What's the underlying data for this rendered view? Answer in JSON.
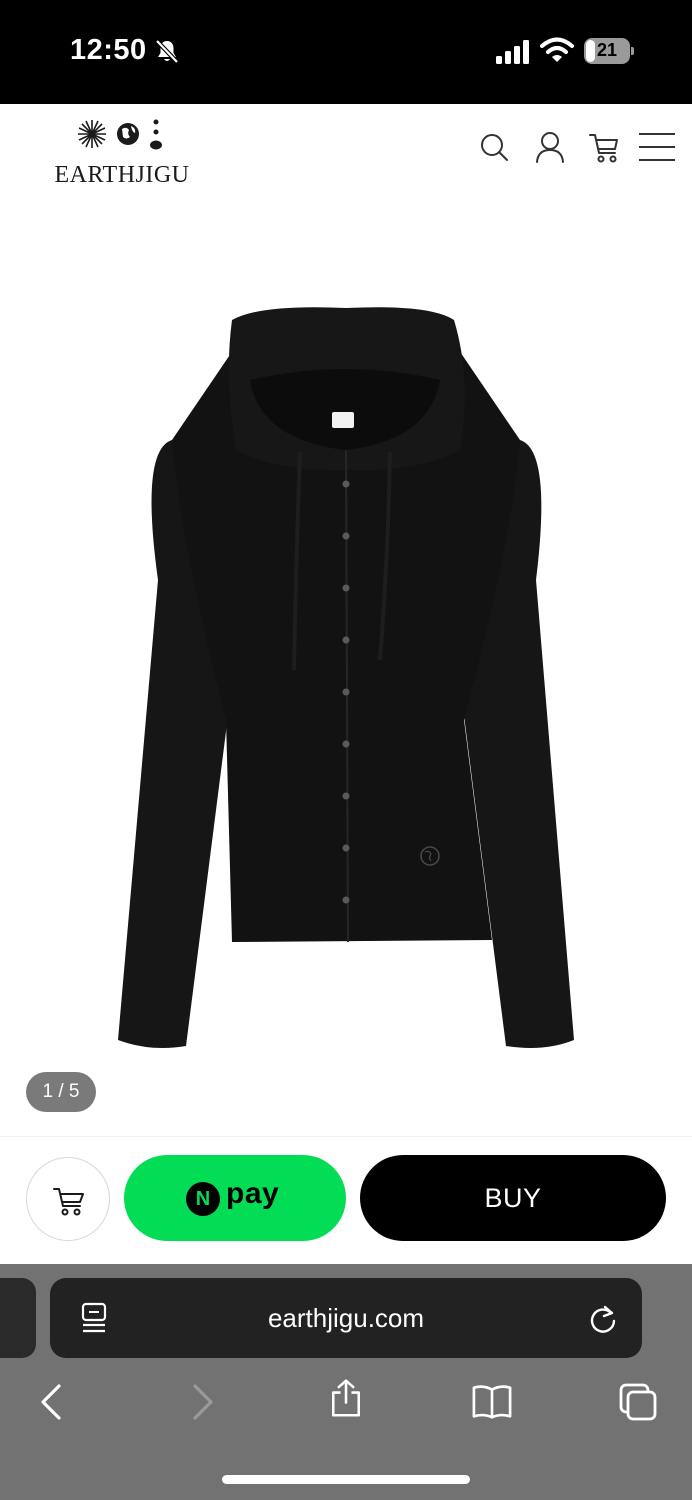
{
  "status_bar": {
    "time": "12:50",
    "battery": "21",
    "battery_level": 0.21,
    "icons": [
      "bell-slash-icon",
      "cellular-signal-icon",
      "wifi-icon",
      "battery-icon"
    ]
  },
  "header": {
    "logo_text": "EARTHJIGU",
    "icons": [
      "search-icon",
      "user-icon",
      "cart-icon",
      "menu-icon"
    ]
  },
  "gallery": {
    "image": "black-ribbed-hooded-button-cardigan",
    "counter": "1 / 5"
  },
  "purchase_bar": {
    "cart_icon": "cart-icon",
    "npay_badge": "N",
    "npay_label": "pay",
    "buy_label": "BUY",
    "colors": {
      "npay": "#03dd55",
      "buy": "#000000"
    }
  },
  "browser": {
    "url": "earthjigu.com",
    "icons": [
      "reader-icon",
      "reload-icon",
      "back-icon",
      "forward-icon",
      "share-icon",
      "bookmarks-icon",
      "tabs-icon"
    ]
  }
}
